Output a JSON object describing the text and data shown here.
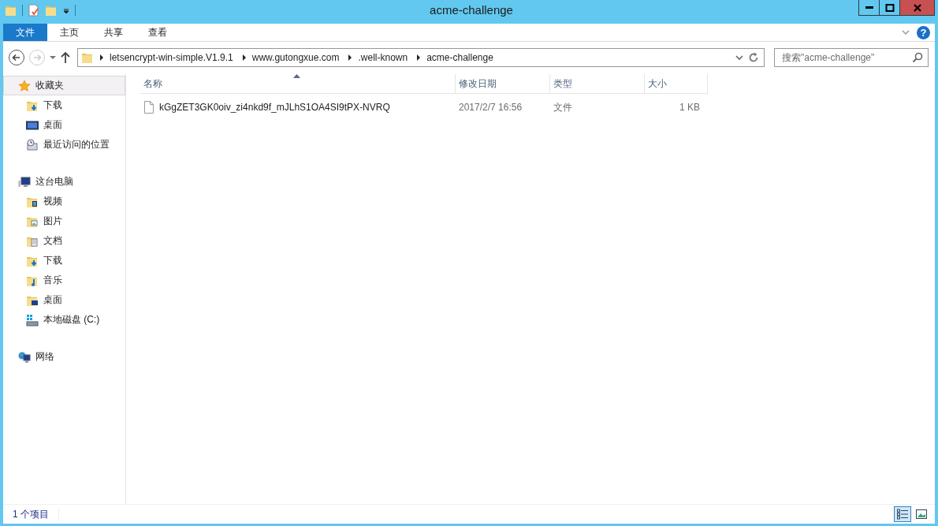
{
  "window": {
    "title": "acme-challenge"
  },
  "ribbon_tabs": [
    {
      "label": "文件",
      "selected": true
    },
    {
      "label": "主页",
      "selected": false
    },
    {
      "label": "共享",
      "selected": false
    },
    {
      "label": "查看",
      "selected": false
    }
  ],
  "help_button": {
    "label": "?"
  },
  "address_bar": {
    "segments": [
      "letsencrypt-win-simple.V1.9.1",
      "www.gutongxue.com",
      ".well-known",
      "acme-challenge"
    ]
  },
  "search": {
    "placeholder": "搜索\"acme-challenge\""
  },
  "sidebar": {
    "items": [
      {
        "label": "收藏夹",
        "kind": "favorites",
        "selected": true,
        "children": [
          {
            "label": "下载",
            "kind": "downloads",
            "selected": false
          },
          {
            "label": "桌面",
            "kind": "desktop",
            "selected": false
          },
          {
            "label": "最近访问的位置",
            "kind": "recent",
            "selected": false
          }
        ]
      },
      {
        "label": "这台电脑",
        "kind": "computer",
        "selected": false,
        "children": [
          {
            "label": "视频",
            "kind": "videos",
            "selected": false
          },
          {
            "label": "图片",
            "kind": "pictures",
            "selected": false
          },
          {
            "label": "文档",
            "kind": "documents",
            "selected": false
          },
          {
            "label": "下载",
            "kind": "downloads-folder",
            "selected": false
          },
          {
            "label": "音乐",
            "kind": "music",
            "selected": false
          },
          {
            "label": "桌面",
            "kind": "desktop-folder",
            "selected": false
          },
          {
            "label": "本地磁盘 (C:)",
            "kind": "drive",
            "selected": false
          }
        ]
      },
      {
        "label": "网络",
        "kind": "network",
        "selected": false
      }
    ]
  },
  "table": {
    "columns": [
      "名称",
      "修改日期",
      "类型",
      "大小"
    ],
    "rows": [
      {
        "cells": [
          "kGgZET3GK0oiv_zi4nkd9f_mJLhS1OA4SI9tPX-NVRQ",
          "2017/2/7 16:56",
          "文件",
          "1 KB"
        ],
        "selected": false
      }
    ]
  },
  "status_bar": {
    "text": "1 个项目",
    "views": [
      {
        "kind": "details",
        "selected": true
      },
      {
        "kind": "thumbnails",
        "selected": false
      }
    ]
  }
}
